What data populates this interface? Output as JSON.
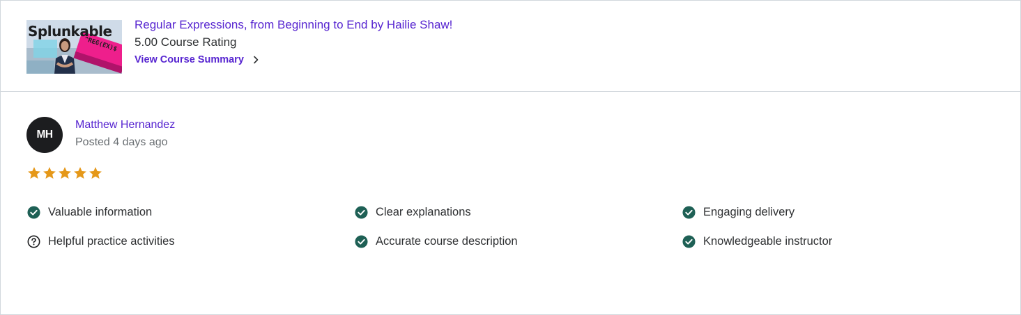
{
  "course": {
    "thumbnail_text": "Splunkable",
    "thumbnail_badge": "^REG(EX)$",
    "title": "Regular Expressions, from Beginning to End by Hailie Shaw!",
    "rating": "5.00 Course Rating",
    "view_summary_label": "View Course Summary",
    "chevron_icon": "chevron-right-icon"
  },
  "review": {
    "avatar_initials": "MH",
    "reviewer_name": "Matthew Hernandez",
    "posted": "Posted 4 days ago",
    "stars": 5,
    "star_color": "#e59819",
    "feedback": [
      {
        "label": "Valuable information",
        "status": "check"
      },
      {
        "label": "Clear explanations",
        "status": "check"
      },
      {
        "label": "Engaging delivery",
        "status": "check"
      },
      {
        "label": "Helpful practice activities",
        "status": "question"
      },
      {
        "label": "Accurate course description",
        "status": "check"
      },
      {
        "label": "Knowledgeable instructor",
        "status": "check"
      }
    ],
    "check_color": "#1e6055",
    "accent_color": "#5624d0"
  }
}
